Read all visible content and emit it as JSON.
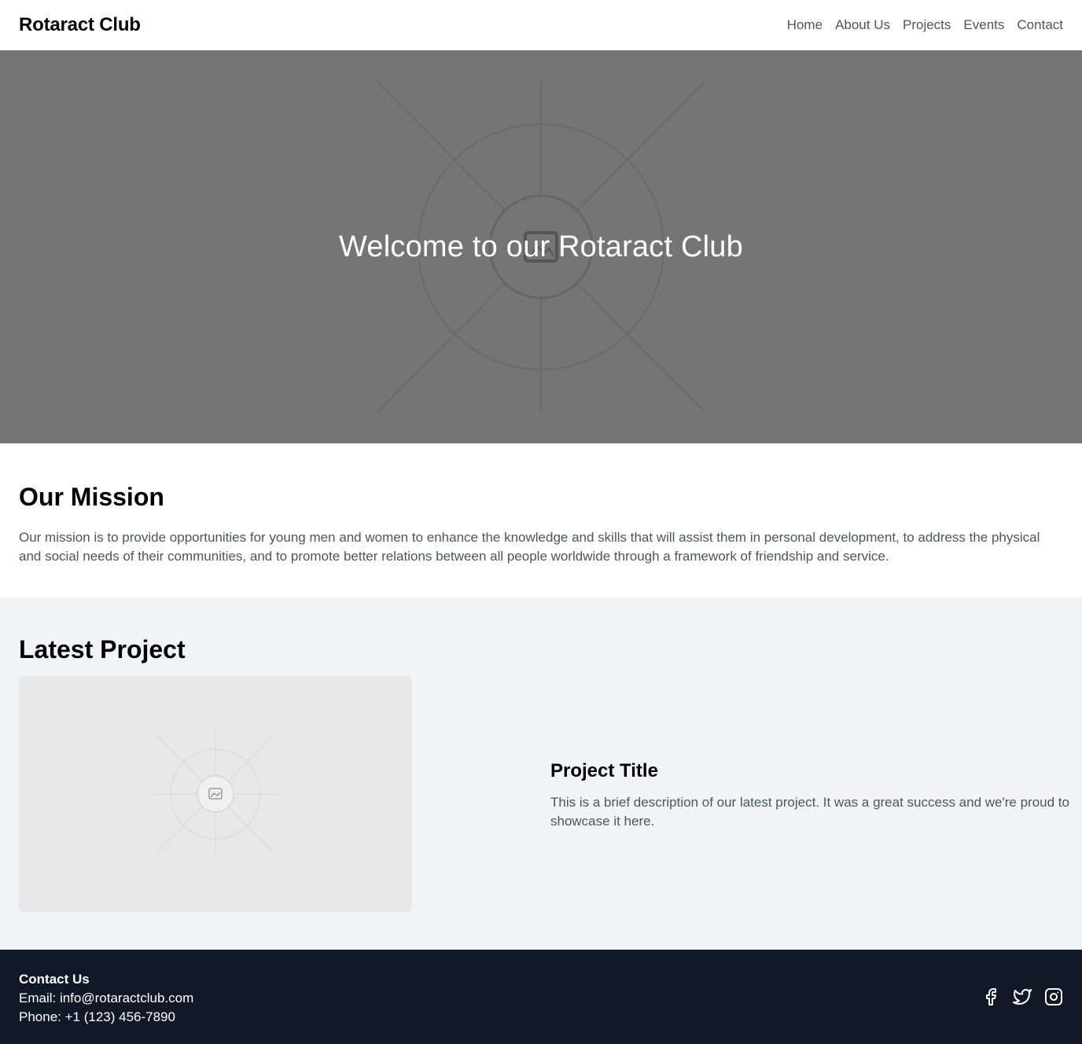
{
  "header": {
    "brand": "Rotaract Club",
    "nav": [
      "Home",
      "About Us",
      "Projects",
      "Events",
      "Contact"
    ]
  },
  "hero": {
    "title": "Welcome to our Rotaract Club"
  },
  "mission": {
    "heading": "Our Mission",
    "text": "Our mission is to provide opportunities for young men and women to enhance the knowledge and skills that will assist them in personal development, to address the physical and social needs of their communities, and to promote better relations between all people worldwide through a framework of friendship and service."
  },
  "latest_project": {
    "heading": "Latest Project",
    "title": "Project Title",
    "description": "This is a brief description of our latest project. It was a great success and we're proud to showcase it here."
  },
  "footer": {
    "heading": "Contact Us",
    "email": "Email: info@rotaractclub.com",
    "phone": "Phone: +1 (123) 456-7890",
    "socials": [
      "facebook-icon",
      "twitter-icon",
      "instagram-icon"
    ]
  },
  "colors": {
    "hero_bg": "#757575",
    "section_bg": "#f2f4f6",
    "footer_bg": "#111827",
    "body_text": "#4b5563"
  }
}
